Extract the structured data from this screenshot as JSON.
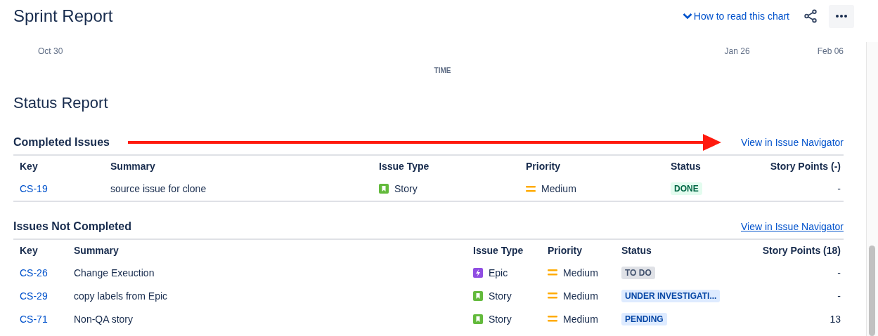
{
  "header": {
    "title": "Sprint Report",
    "help_link": "How to read this chart"
  },
  "chart_axis": {
    "dates": [
      "Oct 30",
      "Jan 26",
      "Feb 06"
    ],
    "axis_title": "TIME"
  },
  "status_report": {
    "title": "Status Report"
  },
  "sections": [
    {
      "title": "Completed Issues",
      "link": {
        "label": "View in Issue Navigator",
        "hovered": false
      },
      "annotated": true,
      "columns": [
        "Key",
        "Summary",
        "Issue Type",
        "Priority",
        "Status",
        "Story Points (-)"
      ],
      "rows": [
        {
          "key": "CS-19",
          "summary": "source issue for clone",
          "type": {
            "kind": "story",
            "label": "Story"
          },
          "priority": {
            "kind": "medium",
            "label": "Medium"
          },
          "status": {
            "kind": "done",
            "label": "DONE"
          },
          "points": "-"
        }
      ]
    },
    {
      "title": "Issues Not Completed",
      "link": {
        "label": "View in Issue Navigator",
        "hovered": true
      },
      "annotated": false,
      "columns": [
        "Key",
        "Summary",
        "Issue Type",
        "Priority",
        "Status",
        "Story Points (18)"
      ],
      "rows": [
        {
          "key": "CS-26",
          "summary": "Change Exeuction",
          "type": {
            "kind": "epic",
            "label": "Epic"
          },
          "priority": {
            "kind": "medium",
            "label": "Medium"
          },
          "status": {
            "kind": "todo",
            "label": "TO DO"
          },
          "points": "-"
        },
        {
          "key": "CS-29",
          "summary": "copy labels from Epic",
          "type": {
            "kind": "story",
            "label": "Story"
          },
          "priority": {
            "kind": "medium",
            "label": "Medium"
          },
          "status": {
            "kind": "inprogress",
            "label": "UNDER INVESTIGATI..."
          },
          "points": "-"
        },
        {
          "key": "CS-71",
          "summary": "Non-QA story",
          "type": {
            "kind": "story",
            "label": "Story"
          },
          "priority": {
            "kind": "medium",
            "label": "Medium"
          },
          "status": {
            "kind": "inprogress",
            "label": "PENDING"
          },
          "points": "13"
        }
      ]
    }
  ]
}
